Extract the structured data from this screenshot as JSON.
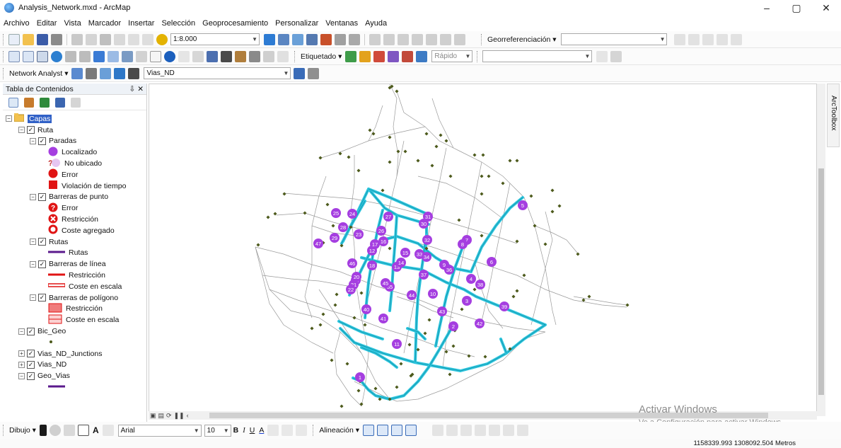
{
  "window": {
    "title": "Analysis_Network.mxd - ArcMap",
    "controls": [
      "–",
      "▢",
      "✕"
    ]
  },
  "menu": [
    "Archivo",
    "Editar",
    "Vista",
    "Marcador",
    "Insertar",
    "Selección",
    "Geoprocesamiento",
    "Personalizar",
    "Ventanas",
    "Ayuda"
  ],
  "toolbar1": {
    "scale": "1:8.000",
    "georef_label": "Georreferenciación ▾"
  },
  "toolbar2": {
    "label_menu": "Etiquetado ▾",
    "rapido": "Rápido"
  },
  "toolbar3": {
    "network_analyst": "Network Analyst ▾",
    "network_dataset": "Vias_ND"
  },
  "toc": {
    "title": "Tabla de Contenidos",
    "pin_close": "⇩ ✕",
    "nodes": [
      {
        "label": "Capas",
        "level": 0,
        "exp": "−",
        "check": false,
        "sym": "folder"
      },
      {
        "label": "Ruta",
        "level": 1,
        "exp": "−",
        "check": true,
        "sym": ""
      },
      {
        "label": "Paradas",
        "level": 2,
        "exp": "−",
        "check": true,
        "sym": ""
      },
      {
        "label": "Localizado",
        "level": 3,
        "sym": "dot-purple"
      },
      {
        "label": "No ubicado",
        "level": 3,
        "sym": "dot-unloc"
      },
      {
        "label": "Error",
        "level": 3,
        "sym": "dot-red"
      },
      {
        "label": "Violación de tiempo",
        "level": 3,
        "sym": "square-red"
      },
      {
        "label": "Barreras de punto",
        "level": 2,
        "exp": "−",
        "check": true,
        "sym": ""
      },
      {
        "label": "Error",
        "level": 3,
        "sym": "qmark-red"
      },
      {
        "label": "Restricción",
        "level": 3,
        "sym": "x-red"
      },
      {
        "label": "Coste agregado",
        "level": 3,
        "sym": "ring-red"
      },
      {
        "label": "Rutas",
        "level": 2,
        "exp": "−",
        "check": true,
        "sym": ""
      },
      {
        "label": "Rutas",
        "level": 3,
        "sym": "line-purple"
      },
      {
        "label": "Barreras de línea",
        "level": 2,
        "exp": "−",
        "check": true,
        "sym": ""
      },
      {
        "label": "Restricción",
        "level": 3,
        "sym": "line-red"
      },
      {
        "label": "Coste en escala",
        "level": 3,
        "sym": "line-redhollow"
      },
      {
        "label": "Barreras de polígono",
        "level": 2,
        "exp": "−",
        "check": true,
        "sym": ""
      },
      {
        "label": "Restricción",
        "level": 3,
        "sym": "poly-red"
      },
      {
        "label": "Coste en escala",
        "level": 3,
        "sym": "poly-redhatch"
      },
      {
        "label": "Bic_Geo",
        "level": 1,
        "exp": "−",
        "check": true,
        "sym": ""
      },
      {
        "label": "",
        "level": 3,
        "sym": "small-dot"
      },
      {
        "label": "Vias_ND_Junctions",
        "level": 1,
        "exp": "+",
        "check": true,
        "sym": ""
      },
      {
        "label": "Vias_ND",
        "level": 1,
        "exp": "+",
        "check": true,
        "sym": ""
      },
      {
        "label": "Geo_Vias",
        "level": 1,
        "exp": "−",
        "check": true,
        "sym": ""
      },
      {
        "label": "",
        "level": 3,
        "sym": "line-purple"
      }
    ]
  },
  "drawing": {
    "menu": "Dibujo ▾",
    "font": "Arial",
    "size": "10",
    "align": "Alineación ▾"
  },
  "status": {
    "coords": "1158339.993  1308092.504 Metros"
  },
  "watermark": {
    "line1": "Activar Windows",
    "line2": "Ve a Configuración para activar Windows."
  },
  "side_tab": "ArcToolbox",
  "colors": {
    "route": "#2cc6de",
    "stop": "#a53ee0",
    "network": "#9a9a9a",
    "junction": "#4d5a1c"
  },
  "stops": [
    "1",
    "2",
    "3",
    "4",
    "5",
    "6",
    "7",
    "8",
    "9",
    "10",
    "11",
    "12",
    "13",
    "14",
    "15",
    "16",
    "17",
    "18",
    "19",
    "20",
    "21",
    "22",
    "23",
    "24",
    "25",
    "26",
    "27",
    "28",
    "29",
    "30",
    "31",
    "32",
    "33",
    "34",
    "35",
    "36",
    "37",
    "38",
    "39",
    "40",
    "41",
    "42",
    "43",
    "44",
    "45",
    "46",
    "47"
  ]
}
